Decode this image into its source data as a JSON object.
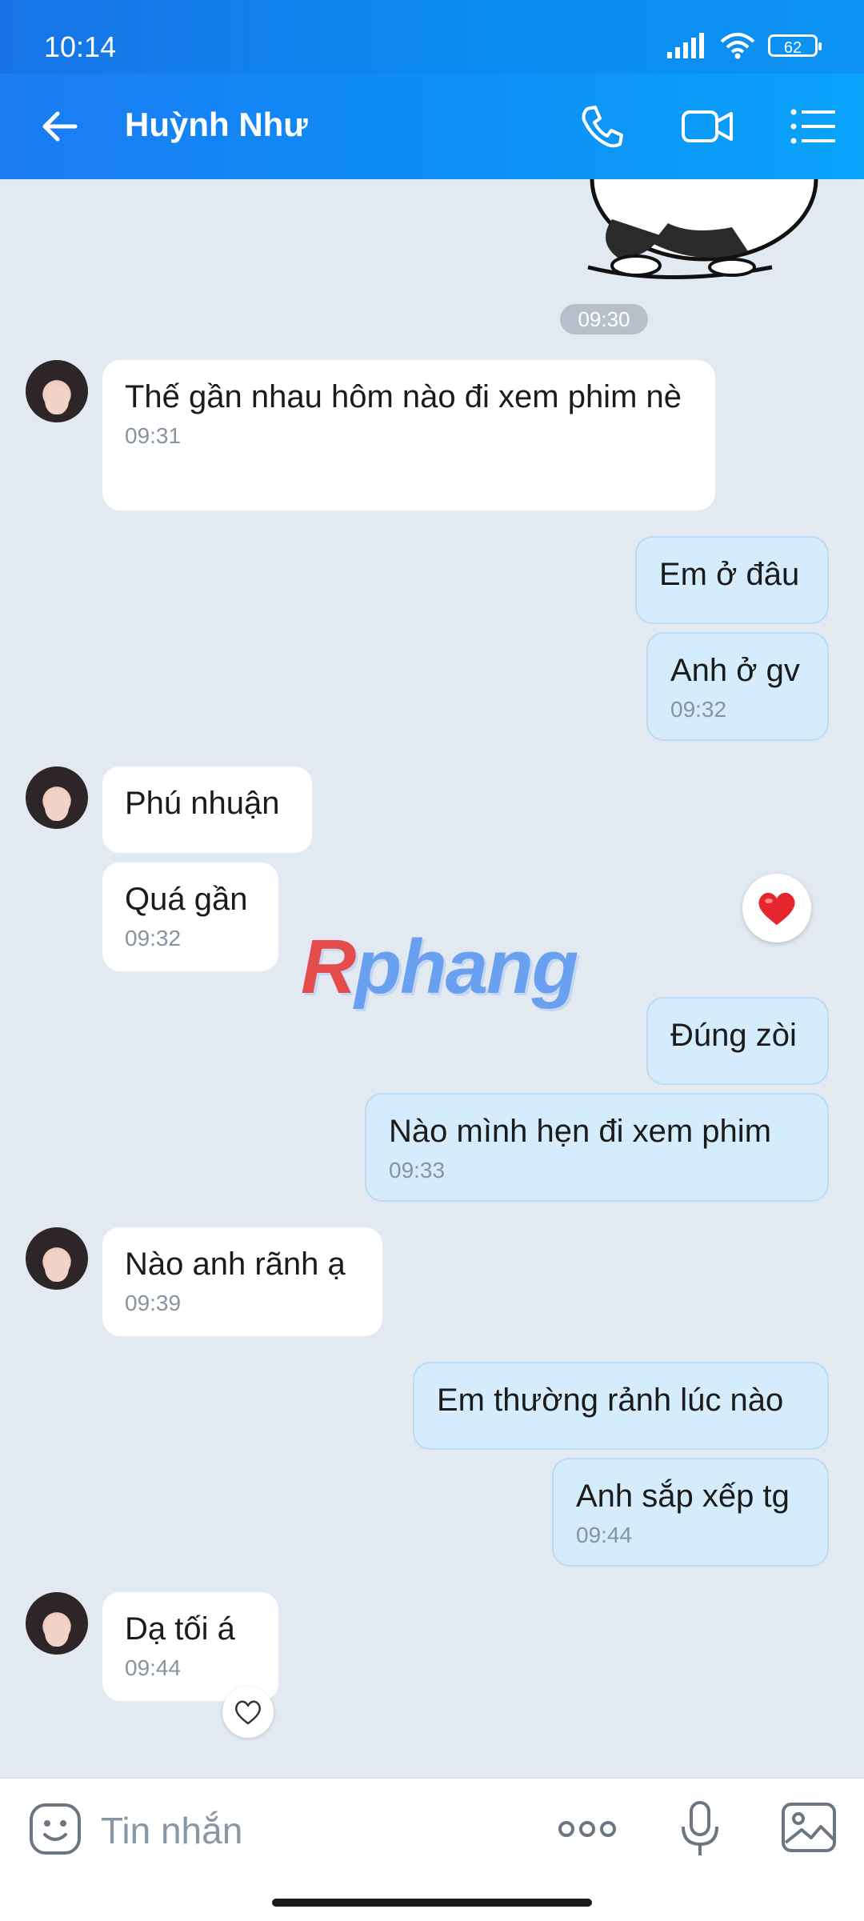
{
  "status_bar": {
    "time": "10:14",
    "battery": "62"
  },
  "header": {
    "contact_name": "Huỳnh Như"
  },
  "chat": {
    "time_divider": "09:30",
    "messages": [
      {
        "side": "received",
        "text": "Thế gần nhau hôm nào đi xem phim nè",
        "time": "09:31"
      },
      {
        "side": "sent",
        "text": "Em ở đâu",
        "time": ""
      },
      {
        "side": "sent",
        "text": "Anh ở gv",
        "time": "09:32"
      },
      {
        "side": "received",
        "text": "Phú nhuận",
        "time": ""
      },
      {
        "side": "received",
        "text": "Quá gần",
        "time": "09:32"
      },
      {
        "side": "sent",
        "text": "Đúng zòi",
        "time": ""
      },
      {
        "side": "sent",
        "text": "Nào mình hẹn đi xem phim",
        "time": "09:33"
      },
      {
        "side": "received",
        "text": "Nào anh rãnh ạ",
        "time": "09:39"
      },
      {
        "side": "sent",
        "text": "Em thường rảnh lúc nào",
        "time": ""
      },
      {
        "side": "sent",
        "text": "Anh sắp xếp tg",
        "time": "09:44"
      },
      {
        "side": "received",
        "text": "Dạ tối á",
        "time": "09:44"
      }
    ]
  },
  "watermark": {
    "r": "R",
    "rest": "phang"
  },
  "input": {
    "placeholder": "Tin nhắn"
  }
}
